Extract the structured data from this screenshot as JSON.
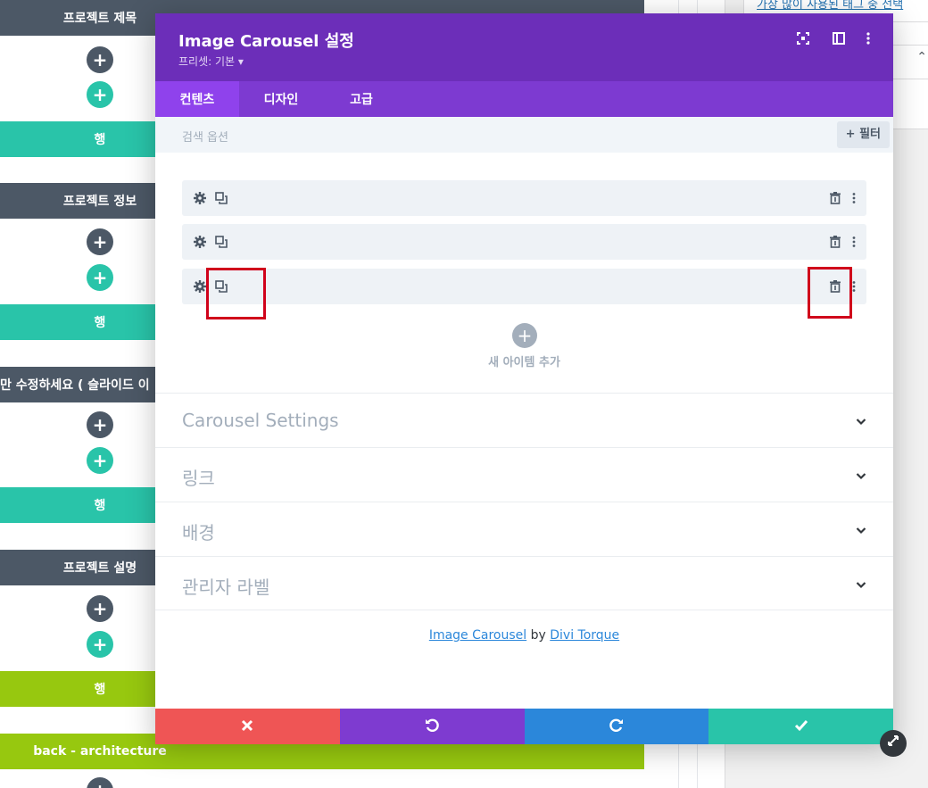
{
  "builder": {
    "bars": [
      {
        "label": "프로젝트 제목",
        "style": "dark"
      },
      {
        "label": "행",
        "style": "teal"
      },
      {
        "label": "프로젝트 정보",
        "style": "dark"
      },
      {
        "label": "행",
        "style": "teal"
      },
      {
        "label": "만 수정하세요 ( 슬라이드 이",
        "style": "dark"
      },
      {
        "label": "행",
        "style": "teal"
      },
      {
        "label": "프로젝트 설명",
        "style": "dark"
      },
      {
        "label": "행",
        "style": "lime"
      },
      {
        "label": "back - architecture",
        "style": "lime"
      }
    ]
  },
  "side_panel": {
    "tag_link": "가장 많이 사용된 태그 중 선택"
  },
  "modal": {
    "title": "Image Carousel 설정",
    "preset": "프리셋: 기본 ▾",
    "tabs": [
      "컨텐츠",
      "디자인",
      "고급"
    ],
    "active_tab": 0,
    "search_placeholder": "검색 옵션",
    "filter_label": "필터",
    "items_count": 3,
    "add_item_label": "새 아이템 추가",
    "sections": [
      "Carousel Settings",
      "링크",
      "배경",
      "관리자 라벨"
    ],
    "credit": {
      "plugin": "Image Carousel",
      "by": "by",
      "author": "Divi Torque"
    }
  },
  "colors": {
    "header": "#6c2eb9",
    "tabs": "#7d3ad1",
    "active_tab": "#8f42ec",
    "cancel": "#ef5555",
    "undo": "#7e3bd0",
    "redo": "#2b87da",
    "save": "#29c4a9",
    "annotation": "#d0021b"
  }
}
